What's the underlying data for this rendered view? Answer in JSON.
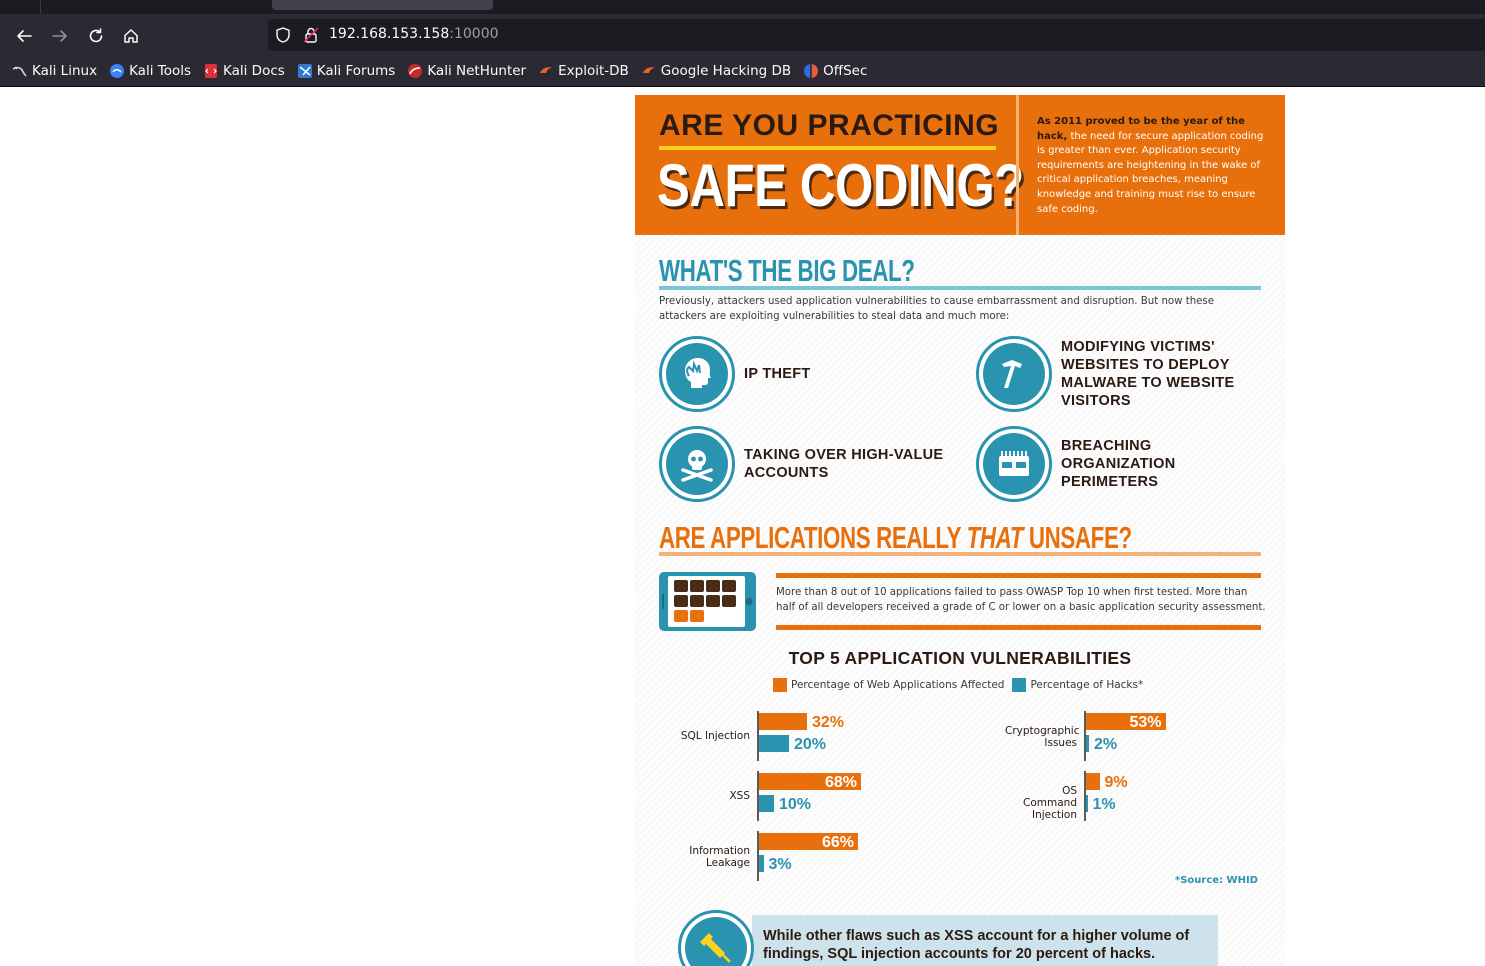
{
  "browser": {
    "url_host": "192.168.153.158",
    "url_port": ":10000",
    "bookmarks": [
      {
        "label": "Kali Linux",
        "icon": "kali-dragon-icon"
      },
      {
        "label": "Kali Tools",
        "icon": "kali-tools-icon"
      },
      {
        "label": "Kali Docs",
        "icon": "kali-docs-icon"
      },
      {
        "label": "Kali Forums",
        "icon": "kali-forums-icon"
      },
      {
        "label": "Kali NetHunter",
        "icon": "kali-nethunter-icon"
      },
      {
        "label": "Exploit-DB",
        "icon": "exploit-db-icon"
      },
      {
        "label": "Google Hacking DB",
        "icon": "google-hacking-db-icon"
      },
      {
        "label": "OffSec",
        "icon": "offsec-icon"
      }
    ]
  },
  "colors": {
    "orange": "#e8700c",
    "teal": "#2a93b0",
    "dark_brown": "#2a1a12",
    "yellow": "#fdd21e"
  },
  "infographic": {
    "hero": {
      "line1": "ARE YOU PRACTICING",
      "line2": "SAFE CODING?",
      "intro_bold": "As 2011 proved to be the year of the hack,",
      "intro_rest": "the need for secure application coding is greater than ever. Application security requirements are heightening in the wake of critical application breaches, meaning knowledge and training must rise to ensure safe coding."
    },
    "big_deal": {
      "title": "WHAT'S THE BIG DEAL?",
      "text": "Previously, attackers used application vulnerabilities to cause embarrassment and disruption. But now these attackers are exploiting vulnerabilities to steal data and much more:",
      "threats": [
        {
          "label": "IP THEFT",
          "icon": "head-hand-icon"
        },
        {
          "label": "MODIFYING VICTIMS' WEBSITES TO DEPLOY MALWARE TO WEBSITE VISITORS",
          "icon": "hammer-icon"
        },
        {
          "label": "TAKING OVER HIGH-VALUE ACCOUNTS",
          "icon": "skull-crossbones-icon"
        },
        {
          "label": "BREACHING ORGANIZATION PERIMETERS",
          "icon": "calendar-binder-icon"
        }
      ]
    },
    "unsafe": {
      "title_a": "ARE APPLICATIONS REALLY ",
      "title_em": "THAT",
      "title_b": " UNSAFE?",
      "stat": "More than 8 out of 10 applications failed to pass OWASP Top 10 when first tested. More than half of all developers received a grade of C or lower on a basic application security assessment.",
      "icon": "tablet-grid-icon"
    },
    "callout": {
      "text": "While other flaws such as XSS account for a higher volume of findings, SQL injection accounts for 20 percent of hacks.",
      "icon": "syringe-icon"
    }
  },
  "chart_data": {
    "type": "bar",
    "orientation": "horizontal",
    "title": "TOP 5 APPLICATION VULNERABILITIES",
    "categories": [
      "SQL Injection",
      "XSS",
      "Information Leakage",
      "Cryptographic Issues",
      "OS Command Injection"
    ],
    "series": [
      {
        "name": "Percentage of Web Applications Affected",
        "values": [
          32,
          68,
          66,
          53,
          9
        ],
        "labels": [
          "32%",
          "68%",
          "66%",
          "53%",
          "9%"
        ]
      },
      {
        "name": "Percentage of Hacks*",
        "values": [
          20,
          10,
          3,
          2,
          1
        ],
        "labels": [
          "20%",
          "10%",
          "3%",
          "2%",
          "1%"
        ]
      }
    ],
    "footnote": "*Source: WHID",
    "grid": false,
    "legend_position": "top"
  }
}
